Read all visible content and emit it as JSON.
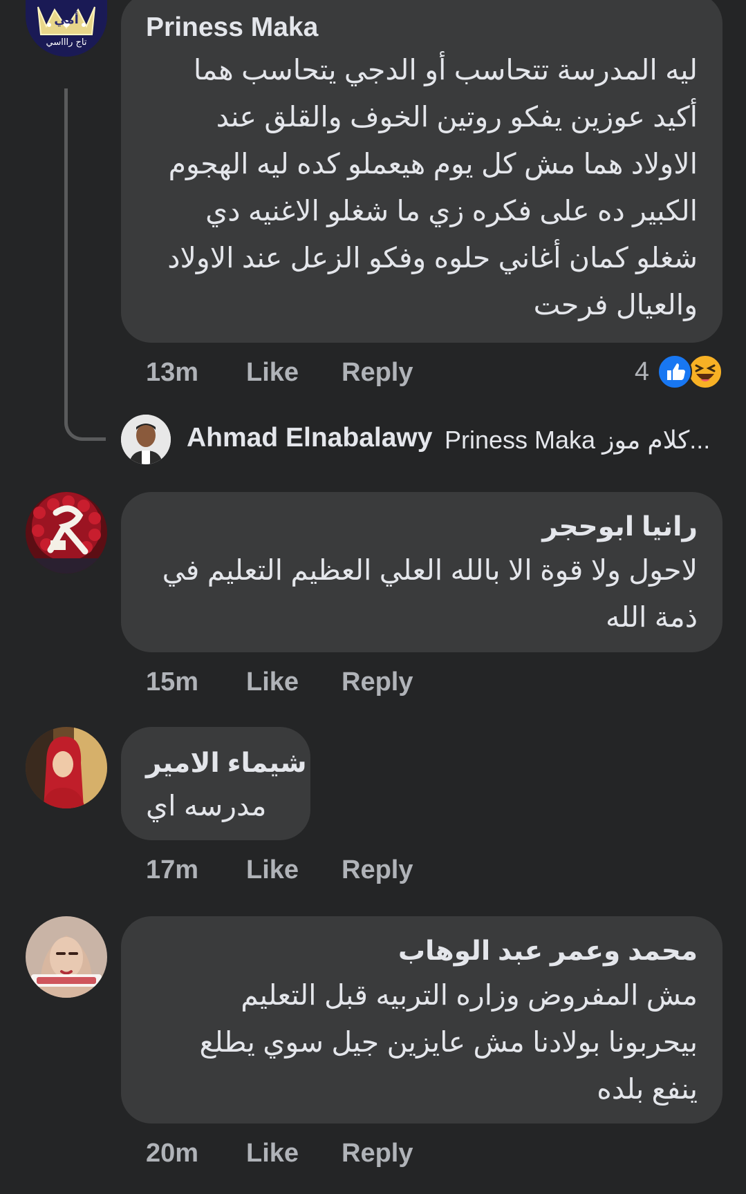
{
  "comments": [
    {
      "author": "Priness Maka",
      "text": "ليه المدرسة تتحاسب أو الدجي يتحاسب هما\nأكيد عوزين يفكو روتين الخوف والقلق عند\nالاولاد هما مش كل يوم هيعملو كده ليه الهجوم\nالكبير ده على فكره زي ما شغلو الاغنيه دي\nشغلو كمان أغاني حلوه وفكو الزعل عند الاولاد\nوالعيال فرحت",
      "avatar_caption_top": "أمي",
      "avatar_caption_bottom": "تاج راااسي",
      "time": "13m",
      "like": "Like",
      "reply": "Reply",
      "reaction_count": "4",
      "reactions": [
        "like-icon",
        "haha-icon"
      ]
    },
    {
      "author": "رانيا ابوحجر",
      "text": "لاحول ولا قوة الا بالله العلي العظيم التعليم في\nذمة الله",
      "time": "15m",
      "like": "Like",
      "reply": "Reply"
    },
    {
      "author": "شيماء الامير",
      "text": "مدرسه اي",
      "time": "17m",
      "like": "Like",
      "reply": "Reply"
    },
    {
      "author": "محمد وعمر عبد الوهاب",
      "text": "مش المفروض وزاره التربيه قبل التعليم\nبيحربونا بولادنا مش عايزين جيل سوي يطلع\nينفع بلده",
      "time": "20m",
      "like": "Like",
      "reply": "Reply"
    }
  ],
  "reply_preview": {
    "author": "Ahmad Elnabalawy",
    "snippet": "Priness Maka كلام موز..."
  },
  "colors": {
    "background": "#242526",
    "bubble": "#3a3b3c",
    "text": "#e4e6eb",
    "secondary": "#b0b3b8",
    "like_blue": "#1877f2",
    "haha_yellow": "#f7b125"
  }
}
